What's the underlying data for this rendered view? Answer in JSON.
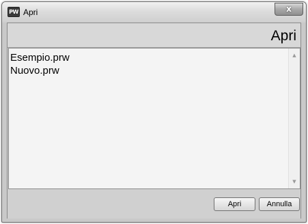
{
  "window": {
    "app_icon_text": "PW",
    "title": "Apri",
    "close_label": "x"
  },
  "header": {
    "title": "Apri"
  },
  "file_list": {
    "items": [
      "Esempio.prw",
      "Nuovo.prw"
    ]
  },
  "scrollbar": {
    "up_arrow": "▲",
    "down_arrow": "▼"
  },
  "buttons": {
    "open_label": "Apri",
    "cancel_label": "Annulla"
  }
}
